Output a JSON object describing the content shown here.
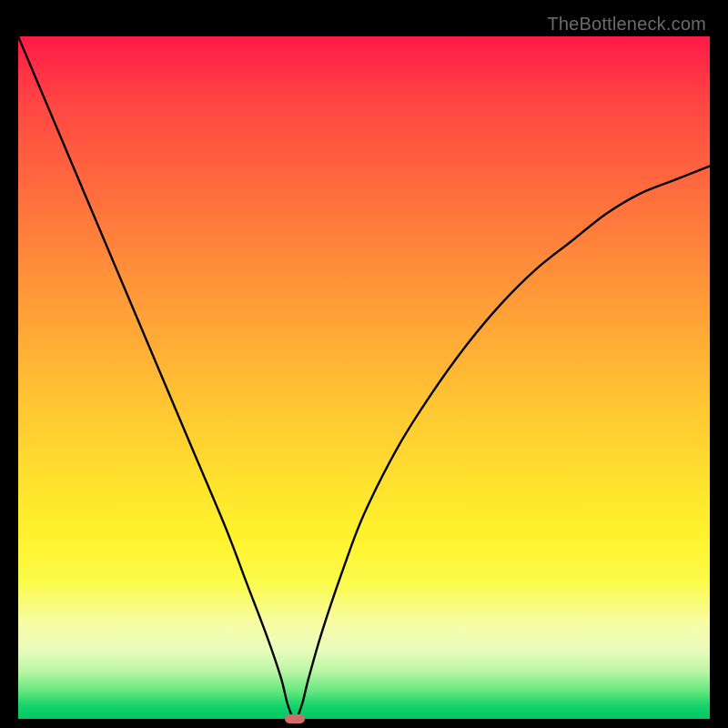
{
  "watermark": "TheBottleneck.com",
  "chart_data": {
    "type": "line",
    "title": "",
    "xlabel": "",
    "ylabel": "",
    "xlim": [
      0,
      100
    ],
    "ylim": [
      0,
      100
    ],
    "grid": false,
    "series": [
      {
        "name": "bottleneck-curve",
        "x": [
          0,
          5,
          10,
          15,
          20,
          25,
          30,
          33,
          36,
          38,
          39,
          40,
          41,
          42,
          44,
          47,
          50,
          55,
          60,
          65,
          70,
          75,
          80,
          85,
          90,
          95,
          100
        ],
        "y": [
          100,
          88,
          76,
          64,
          52,
          40,
          28,
          20,
          12,
          6,
          2,
          0,
          2,
          6,
          13,
          22,
          30,
          40,
          48,
          55,
          61,
          66,
          70,
          74,
          77,
          79,
          81
        ]
      }
    ],
    "minimum": {
      "x": 40,
      "y": 0
    },
    "gradient_stops": [
      {
        "pos": 0,
        "color": "#ff1a49"
      },
      {
        "pos": 22,
        "color": "#ff6a3e"
      },
      {
        "pos": 44,
        "color": "#ffaa36"
      },
      {
        "pos": 66,
        "color": "#ffe32e"
      },
      {
        "pos": 86,
        "color": "#f7fca6"
      },
      {
        "pos": 96,
        "color": "#63e67e"
      },
      {
        "pos": 100,
        "color": "#00c763"
      }
    ]
  }
}
